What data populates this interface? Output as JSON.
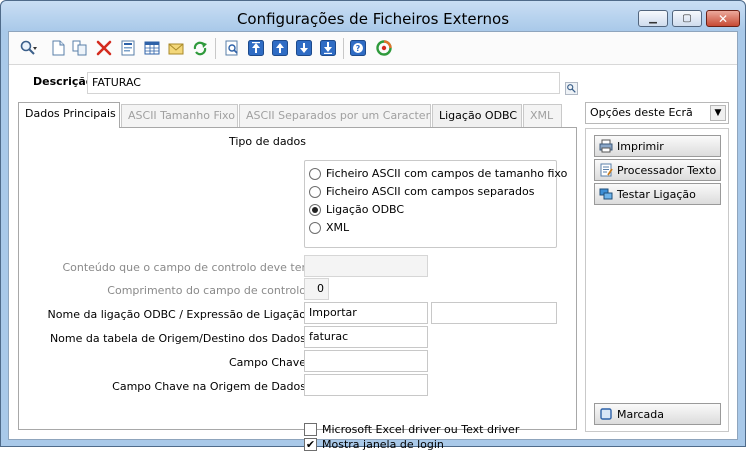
{
  "window": {
    "title": "Configurações de Ficheiros Externos",
    "controls": {
      "minimize": "▁",
      "maximize": "▢",
      "close": "✕"
    }
  },
  "toolbar": {
    "icons": [
      "search-icon",
      "new-document-icon",
      "copy-document-icon",
      "delete-icon",
      "properties-icon",
      "grid-icon",
      "mail-icon",
      "refresh-icon",
      "preview-icon",
      "first-record-icon",
      "previous-record-icon",
      "next-record-icon",
      "last-record-icon",
      "help-icon",
      "exit-icon"
    ]
  },
  "description": {
    "label": "Descrição",
    "value": "FATURAC"
  },
  "tabs": [
    "Dados Principais",
    "ASCII Tamanho Fixo",
    "ASCII Separados por um Caracter",
    "Ligação ODBC",
    "XML"
  ],
  "main": {
    "tipo_label": "Tipo de dados",
    "options": [
      "Ficheiro ASCII com campos de tamanho fixo",
      "Ficheiro ASCII com campos separados",
      "Ligação ODBC",
      "XML"
    ],
    "selected_option": 2,
    "controlo_label": "Conteúdo que o campo de controlo deve ter",
    "controlo_value": "",
    "comprimento_label": "Comprimento do campo de controlo",
    "comprimento_value": "0",
    "ligacao_label": "Nome da ligação ODBC / Expressão de Ligação",
    "ligacao_value": "Importar",
    "ligacao_extra": "",
    "tabela_label": "Nome da tabela de Origem/Destino dos Dados",
    "tabela_value": "faturac",
    "chave_label": "Campo Chave",
    "chave_value": "",
    "chave_origem_label": "Campo Chave na Origem de Dados",
    "chave_origem_value": "",
    "excel_label": "Microsoft Excel driver ou Text driver",
    "excel_checked": false,
    "login_label": "Mostra janela de login",
    "login_checked": true
  },
  "side": {
    "select_value": "Opções deste Ecrã",
    "buttons": [
      "Imprimir",
      "Processador Texto",
      "Testar Ligação"
    ],
    "marcada": "Marcada"
  }
}
